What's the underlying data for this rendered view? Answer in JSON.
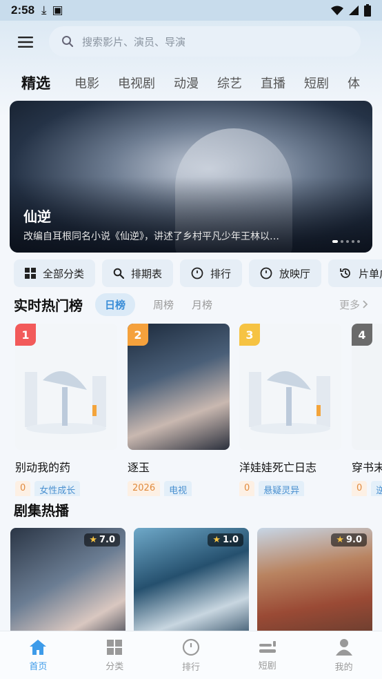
{
  "status_bar": {
    "time": "2:58"
  },
  "search": {
    "placeholder": "搜索影片、演员、导演"
  },
  "tabs": [
    {
      "label": "精选",
      "active": true
    },
    {
      "label": "电影"
    },
    {
      "label": "电视剧"
    },
    {
      "label": "动漫"
    },
    {
      "label": "综艺"
    },
    {
      "label": "直播"
    },
    {
      "label": "短剧"
    },
    {
      "label": "体"
    }
  ],
  "banner": {
    "title": "仙逆",
    "description": "改编自耳根同名小说《仙逆》，讲述了乡村平凡少年王林以…"
  },
  "chips": [
    {
      "label": "全部分类",
      "icon": "grid-icon"
    },
    {
      "label": "排期表",
      "icon": "search-icon"
    },
    {
      "label": "排行",
      "icon": "rank-icon"
    },
    {
      "label": "放映厅",
      "icon": "rank-icon"
    },
    {
      "label": "片单广场",
      "icon": "history-icon"
    }
  ],
  "ranking": {
    "title": "实时热门榜",
    "tabs": [
      "日榜",
      "周榜",
      "月榜"
    ],
    "more": "更多",
    "items": [
      {
        "rank": "1",
        "name": "别动我的药",
        "tag1": "0",
        "tag2": "女性成长",
        "badge_color": "#f25a5a"
      },
      {
        "rank": "2",
        "name": "逐玉",
        "tag1": "2026",
        "tag2": "电视",
        "badge_color": "#f5a13c"
      },
      {
        "rank": "3",
        "name": "洋娃娃死亡日志",
        "tag1": "0",
        "tag2": "悬疑灵异",
        "badge_color": "#f6c343"
      },
      {
        "rank": "4",
        "name": "穿书末",
        "tag1": "0",
        "tag2": "逆",
        "badge_color": "#6b6b6b"
      }
    ]
  },
  "dramas": {
    "title": "剧集热播",
    "items": [
      {
        "score": "7.0"
      },
      {
        "score": "1.0"
      },
      {
        "score": "9.0"
      }
    ]
  },
  "bottom_nav": [
    {
      "label": "首页",
      "icon": "home-icon",
      "active": true
    },
    {
      "label": "分类",
      "icon": "category-icon"
    },
    {
      "label": "排行",
      "icon": "rank-icon"
    },
    {
      "label": "短剧",
      "icon": "short-drama-icon"
    },
    {
      "label": "我的",
      "icon": "profile-icon"
    }
  ],
  "colors": {
    "accent": "#3d9be9",
    "background": "#f4f7fb"
  }
}
